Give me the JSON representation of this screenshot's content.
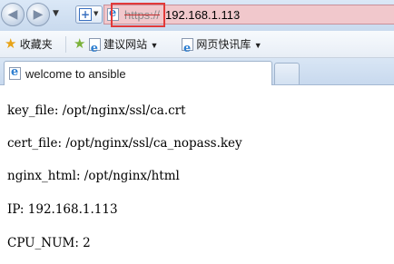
{
  "toolbar": {
    "back_icon": "◀",
    "forward_icon": "▶",
    "history_dropdown_icon": "▼",
    "new_page_icon": "+",
    "new_page_caret": "▼"
  },
  "address": {
    "scheme": "https://",
    "host": "192.168.1.113",
    "path": "/",
    "ssl_warning_color": "#e23a3a",
    "bar_color": "#f1c8cc"
  },
  "favorites": {
    "favorites_label": "收藏夹",
    "suggested_sites_label": "建议网站",
    "web_slice_gallery_label": "网页快讯库",
    "caret": "▼",
    "star_icon": "★",
    "add_star_icon": "★"
  },
  "tabs": [
    {
      "title": "welcome to ansible",
      "active": true
    }
  ],
  "content": {
    "lines": [
      "key_file: /opt/nginx/ssl/ca.crt",
      "cert_file: /opt/nginx/ssl/ca_nopass.key",
      "nginx_html: /opt/nginx/html",
      "IP: 192.168.1.113",
      "CPU_NUM: 2"
    ]
  }
}
